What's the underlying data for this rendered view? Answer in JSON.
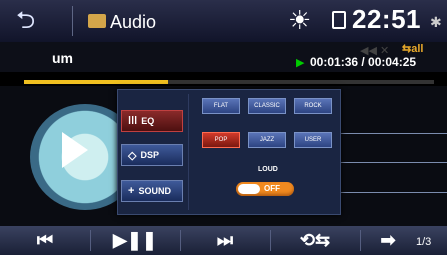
{
  "header": {
    "title": "Audio",
    "clock": "22:51",
    "icons": [
      "back-icon",
      "folder-icon",
      "sun-icon",
      "sd-card-icon",
      "bluetooth-icon"
    ]
  },
  "nowplaying": {
    "track": "um",
    "time": "00:01:36 / 00:04:25",
    "repeat": "all",
    "progress": 0.35
  },
  "menu": {
    "eq": "EQ",
    "dsp": "DSP",
    "sound": "SOUND"
  },
  "presets": [
    {
      "label": "FLAT",
      "active": false
    },
    {
      "label": "CLASSIC",
      "active": false
    },
    {
      "label": "ROCK",
      "active": false
    },
    {
      "label": "POP",
      "active": true
    },
    {
      "label": "JAZZ",
      "active": false
    },
    {
      "label": "USER",
      "active": false
    }
  ],
  "loud": {
    "label": "LOUD",
    "state": "OFF"
  },
  "controls": {
    "page": "1/3",
    "icons": [
      "previous-icon",
      "play-pause-icon",
      "next-icon",
      "repeat-mode-icon",
      "next-page-icon"
    ]
  },
  "colors": {
    "progress": "#f0c020",
    "active_preset": "#d13a2a",
    "toggle": "#f08a20",
    "accent_repeat": "#e8a92a"
  }
}
